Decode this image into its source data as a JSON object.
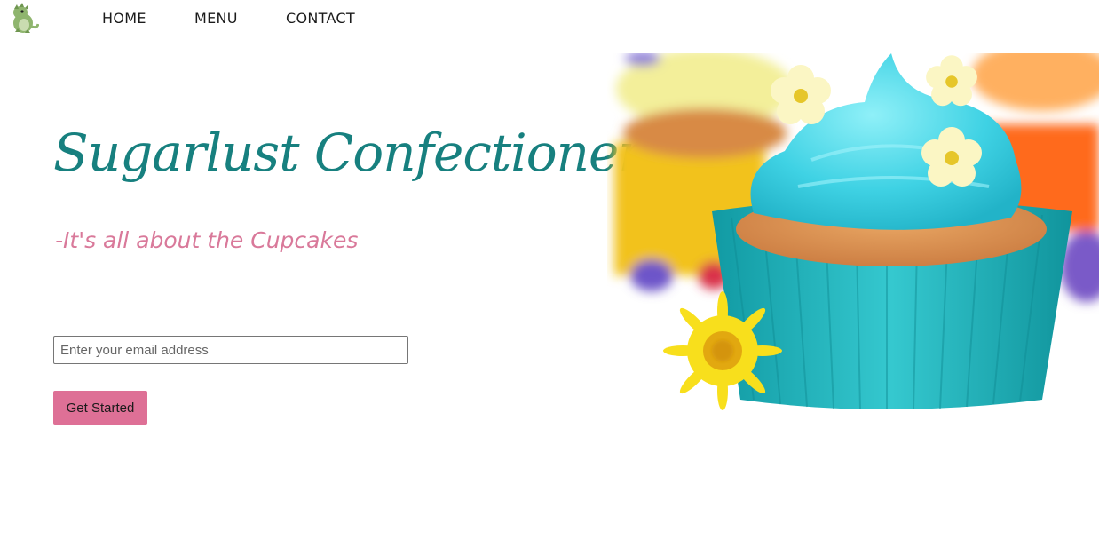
{
  "header": {
    "logo_icon": "dinosaur-logo-icon",
    "nav": [
      {
        "label": "HOME"
      },
      {
        "label": "MENU"
      },
      {
        "label": "CONTACT"
      }
    ]
  },
  "hero": {
    "title": "Sugarlust Confectionery",
    "tagline": "-It's all about the Cupcakes",
    "image_icon": "cupcake-photo",
    "colors": {
      "title": "#17807f",
      "tagline": "#d9799a",
      "button": "#de7096",
      "frosting": "#3fcfe0",
      "liner": "#20b5bd"
    }
  },
  "signup": {
    "email_placeholder": "Enter your email address",
    "email_value": "",
    "button_label": "Get Started"
  }
}
